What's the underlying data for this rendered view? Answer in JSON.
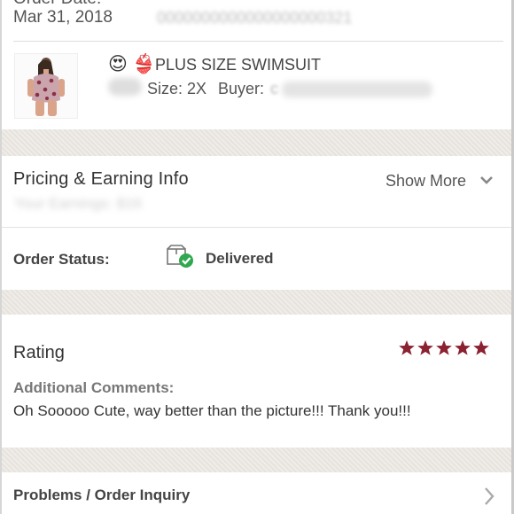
{
  "order": {
    "date_label": "Order Date:",
    "date_value": "Mar 31, 2018",
    "order_number_obscured": "0000000000000000000321"
  },
  "item": {
    "emoji_face": "😍",
    "emoji_bikini": "👙",
    "title": "PLUS SIZE SWIMSUIT",
    "size_text": "Size: 2X",
    "buyer_label": "Buyer:",
    "buyer_obscured": "c"
  },
  "pricing": {
    "title": "Pricing & Earning Info",
    "show_more": "Show More",
    "earnings_obscured": "Your Earnings: $16"
  },
  "status": {
    "label": "Order Status:",
    "value": "Delivered"
  },
  "rating": {
    "title": "Rating",
    "stars": 5,
    "star_color": "#8b2232",
    "comments_label": "Additional Comments:",
    "comments_text": "Oh Sooooo Cute, way better than the picture!!! Thank you!!!"
  },
  "problems": {
    "label": "Problems / Order Inquiry"
  },
  "colors": {
    "check_green": "#2fa84f"
  }
}
